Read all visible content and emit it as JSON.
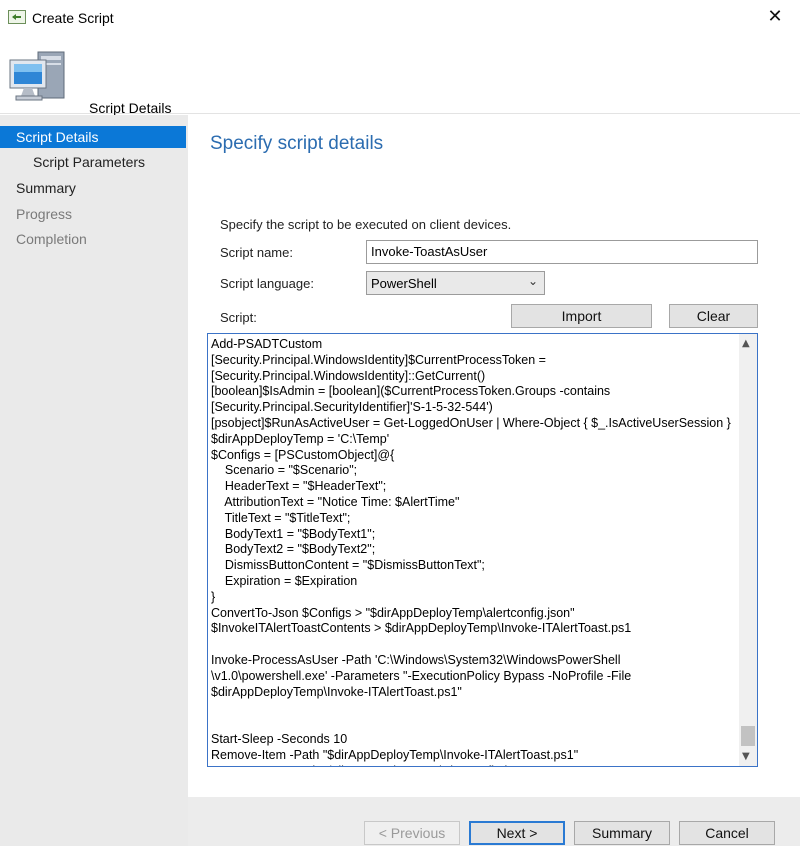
{
  "window": {
    "title": "Create Script"
  },
  "header": {
    "title": "Script Details"
  },
  "sidebar": {
    "items": [
      {
        "label": "Script Details"
      },
      {
        "label": "Script Parameters"
      },
      {
        "label": "Summary"
      },
      {
        "label": "Progress"
      },
      {
        "label": "Completion"
      }
    ]
  },
  "main": {
    "heading": "Specify script details",
    "instruction": "Specify the script to be executed on client devices.",
    "script_name_label": "Script name:",
    "script_name_value": "Invoke-ToastAsUser",
    "script_language_label": "Script language:",
    "script_language_value": "PowerShell",
    "script_label": "Script:",
    "import_label": "Import",
    "clear_label": "Clear",
    "script_body": "Add-PSADTCustom\n[Security.Principal.WindowsIdentity]$CurrentProcessToken =\n[Security.Principal.WindowsIdentity]::GetCurrent()\n[boolean]$IsAdmin = [boolean]($CurrentProcessToken.Groups -contains\n[Security.Principal.SecurityIdentifier]'S-1-5-32-544')\n[psobject]$RunAsActiveUser = Get-LoggedOnUser | Where-Object { $_.IsActiveUserSession }\n$dirAppDeployTemp = 'C:\\Temp'\n$Configs = [PSCustomObject]@{\n    Scenario = \"$Scenario\";\n    HeaderText = \"$HeaderText\";\n    AttributionText = \"Notice Time: $AlertTime\"\n    TitleText = \"$TitleText\";\n    BodyText1 = \"$BodyText1\";\n    BodyText2 = \"$BodyText2\";\n    DismissButtonContent = \"$DismissButtonText\";\n    Expiration = $Expiration\n}\nConvertTo-Json $Configs > \"$dirAppDeployTemp\\alertconfig.json\"\n$InvokeITAlertToastContents > $dirAppDeployTemp\\Invoke-ITAlertToast.ps1\n\nInvoke-ProcessAsUser -Path 'C:\\Windows\\System32\\WindowsPowerShell\n\\v1.0\\powershell.exe' -Parameters \"-ExecutionPolicy Bypass -NoProfile -File\n$dirAppDeployTemp\\Invoke-ITAlertToast.ps1\"\n\n\nStart-Sleep -Seconds 10\nRemove-Item -Path \"$dirAppDeployTemp\\Invoke-ITAlertToast.ps1\"\nRemove-Item -Path \"$dirAppDeployTemp\\alertconfig.json\""
  },
  "footer": {
    "previous_label": "< Previous",
    "next_label": "Next >",
    "summary_label": "Summary",
    "cancel_label": "Cancel"
  },
  "icons": {
    "title": "create-script-icon",
    "close": "close-icon",
    "header": "computer-icon",
    "dropdown": "chevron-down-icon"
  },
  "colors": {
    "accent": "#0b78d7",
    "heading": "#2b6cb0",
    "sidebar_bg": "#eaeaea"
  }
}
